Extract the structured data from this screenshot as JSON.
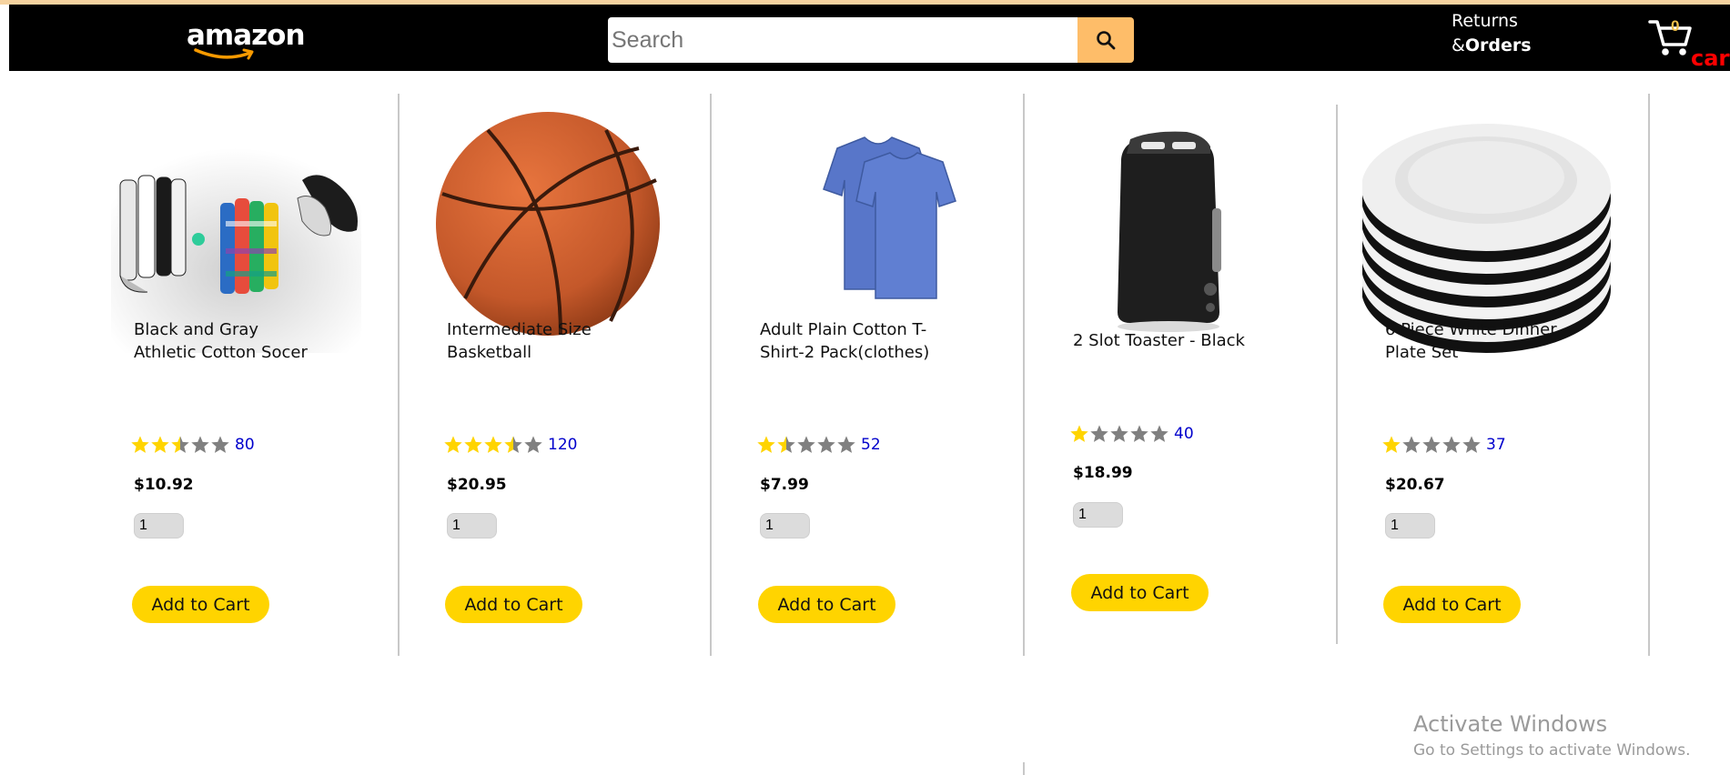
{
  "header": {
    "logo_text": "amazon",
    "search": {
      "placeholder": "Search",
      "value": ""
    },
    "search_icon": "search-icon",
    "orders_line1": "Returns",
    "orders_line2_prefix": "&",
    "orders_line2": "Orders",
    "cart_count": "0",
    "cart_label": "cart",
    "cart_icon": "cart-icon",
    "colors": {
      "bar": "#000000",
      "search_button": "#febd69",
      "cart_label": "#ff0000"
    }
  },
  "products": [
    {
      "name_line1": "Black and Gray",
      "name_line2": "Athletic Cotton Socer",
      "rating_stars": 2.5,
      "rating_count": "80",
      "price": "$10.92",
      "quantity": "1",
      "button_label": "Add to Cart",
      "image": "socks-image"
    },
    {
      "name_line1": "Intermediate Size",
      "name_line2": "Basketball",
      "rating_stars": 3.5,
      "rating_count": "120",
      "price": "$20.95",
      "quantity": "1",
      "button_label": "Add to Cart",
      "image": "basketball-image"
    },
    {
      "name_line1": "Adult Plain Cotton T-",
      "name_line2": "Shirt-2 Pack(clothes)",
      "rating_stars": 1.5,
      "rating_count": "52",
      "price": "$7.99",
      "quantity": "1",
      "button_label": "Add to Cart",
      "image": "tshirt-image"
    },
    {
      "name_line1": "2 Slot Toaster - Black",
      "name_line2": "",
      "rating_stars": 1.0,
      "rating_count": "40",
      "price": "$18.99",
      "quantity": "1",
      "button_label": "Add to Cart",
      "image": "toaster-image"
    },
    {
      "name_line1": "6 Piece White Dinner",
      "name_line2": "Plate Set",
      "rating_stars": 1.0,
      "rating_count": "37",
      "price": "$20.67",
      "quantity": "1",
      "button_label": "Add to Cart",
      "image": "plates-image"
    }
  ],
  "colors": {
    "button": "#ffd400",
    "star_filled": "#ffd400",
    "star_empty": "#808080",
    "rating_count": "#0000cc"
  },
  "watermark": {
    "line1": "Activate Windows",
    "line2": "Go to Settings to activate Windows."
  }
}
